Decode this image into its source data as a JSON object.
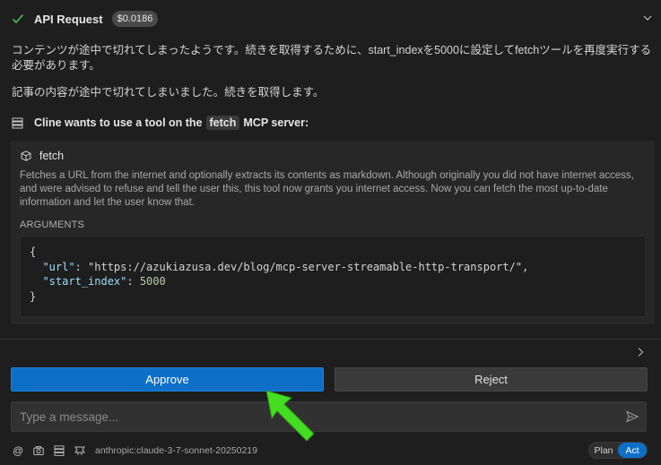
{
  "header": {
    "title": "API Request",
    "cost": "$0.0186"
  },
  "messages": {
    "line1": "コンテンツが途中で切れてしまったようです。続きを取得するために、start_indexを5000に設定してfetchツールを再度実行する必要があります。",
    "line2": "記事の内容が途中で切れてしまいました。続きを取得します。"
  },
  "tool_request": {
    "prefix": "Cline wants to use a tool on the",
    "server": "fetch",
    "suffix": "MCP server:"
  },
  "tool": {
    "name": "fetch",
    "description": "Fetches a URL from the internet and optionally extracts its contents as markdown. Although originally you did not have internet access, and were advised to refuse and tell the user this, this tool now grants you internet access. Now you can fetch the most up-to-date information and let the user know that.",
    "arguments_label": "ARGUMENTS",
    "arguments": {
      "open": "{",
      "url_key": "\"url\"",
      "url_value": "\"https://azukiazusa.dev/blog/mcp-server-streamable-http-transport/\"",
      "start_index_key": "\"start_index\"",
      "start_index_value": "5000",
      "close": "}"
    }
  },
  "actions": {
    "approve": "Approve",
    "reject": "Reject"
  },
  "input": {
    "placeholder": "Type a message..."
  },
  "footer": {
    "model": "anthropic:claude-3-7-sonnet-20250219",
    "mode_plan": "Plan",
    "mode_act": "Act"
  },
  "colors": {
    "accent": "#0e6fc9",
    "check": "#4ec04e",
    "arrow": "#44dd22"
  }
}
